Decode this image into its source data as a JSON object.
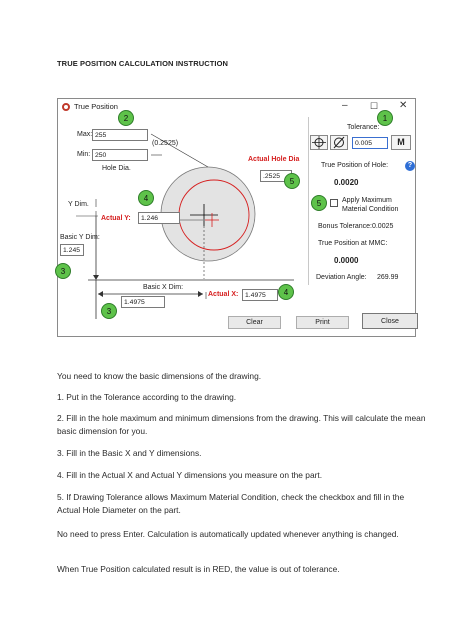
{
  "doc_title": "TRUE POSITION CALCULATION INSTRUCTION",
  "window": {
    "title": "True Position",
    "minimize_glyph": "–",
    "maximize_glyph": "☐",
    "close_glyph": "✕"
  },
  "left": {
    "max_label": "Max:",
    "max_value": "255",
    "min_label": "Min:",
    "min_value": "250",
    "mean_label": "(0.2525)",
    "hole_dia_label": "Hole Dia.",
    "actual_hole_dia_label": "Actual Hole Dia",
    "actual_hole_dia_value": ".2525",
    "y_dim_label": "Y Dim.",
    "actual_y_label": "Actual Y:",
    "actual_y_value": "1.246",
    "basic_y_label": "Basic Y Dim:",
    "basic_y_value": "1.245",
    "basic_x_label": "Basic X Dim:",
    "basic_x_value": "1.4975",
    "actual_x_label": "Actual X:",
    "actual_x_value": "1.4975"
  },
  "right": {
    "tolerance_label": "Tolerance:",
    "tolerance_value": "0.005",
    "mmc_button": "M",
    "tp_hole_label": "True Position of Hole:",
    "tp_hole_value": "0.0020",
    "help_glyph": "?",
    "apply_mmc_line1": "Apply Maximum",
    "apply_mmc_line2": "Material Condition",
    "bonus_label": "Bonus Tolerance:0.0025",
    "tp_mmc_label": "True Position at MMC:",
    "tp_mmc_value": "0.0000",
    "deviation_label": "Deviation Angle:",
    "deviation_value": "269.99"
  },
  "buttons": {
    "clear": "Clear",
    "print": "Print",
    "close": "Close"
  },
  "badges": [
    "1",
    "2",
    "3",
    "3",
    "4",
    "4",
    "5",
    "5"
  ],
  "instructions": [
    "You need to know the basic dimensions of the drawing.",
    "1. Put in the Tolerance according to the drawing.",
    "2. Fill in the hole maximum and minimum dimensions from the drawing. This will calculate the mean basic dimension for you.",
    "3. Fill in the Basic X and Y dimensions.",
    "4. Fill in the Actual X and Actual Y dimensions you measure on the part.",
    "5. If Drawing Tolerance allows Maximum Material Condition, check the checkbox and fill in the Actual Hole Diameter on the part.",
    "No need to press Enter. Calculation is automatically updated whenever anything is changed.",
    "When True Position calculated result is in RED, the value is out of tolerance."
  ],
  "colors": {
    "accent_red": "#d62020",
    "badge_green": "#5ec24a",
    "circle_gray": "#e3e3e3"
  }
}
